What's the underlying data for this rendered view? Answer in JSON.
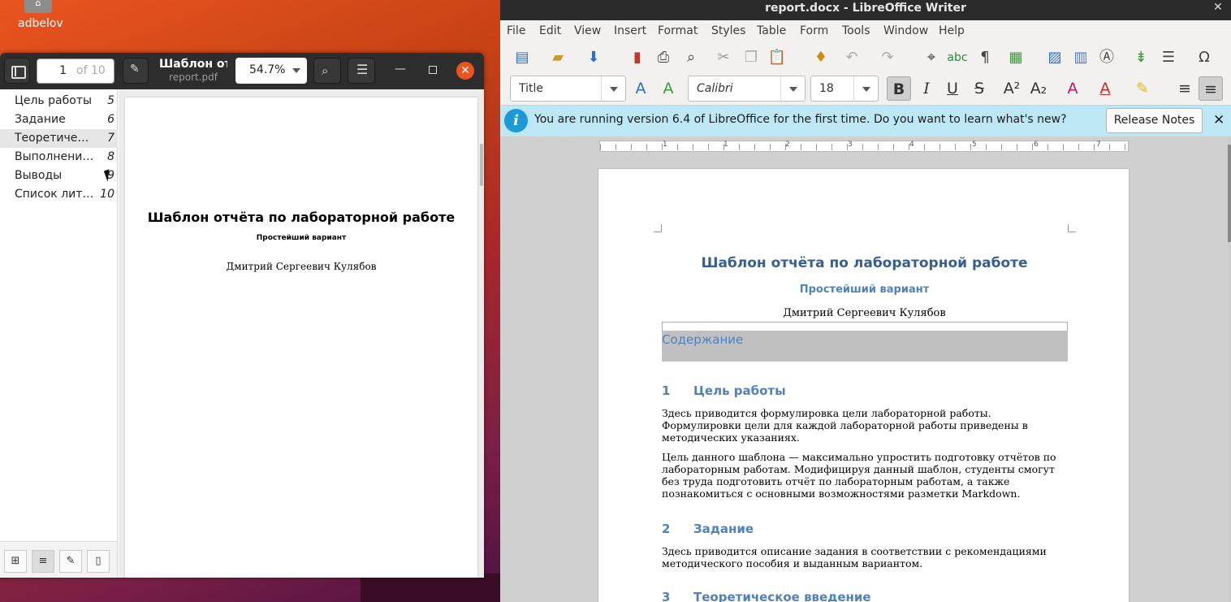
{
  "desktop": {
    "home_label": "adbelov",
    "home_icon_glyph": "⌂"
  },
  "evince": {
    "page_number": "1",
    "page_of": "of 10",
    "title": "Шаблон отчёта по лабораторной работе",
    "subtitle": "report.pdf",
    "zoom": "54.7%",
    "outline": [
      {
        "label": "Цель работы",
        "page": "5"
      },
      {
        "label": "Задание",
        "page": "6"
      },
      {
        "label": "Теоретическое введение",
        "page": "7"
      },
      {
        "label": "Выполнение лабораторной работы",
        "page": "8"
      },
      {
        "label": "Выводы",
        "page": "9"
      },
      {
        "label": "Список литературы",
        "page": "10"
      }
    ],
    "pdf_page": {
      "title": "Шаблон отчёта по лабораторной работе",
      "subtitle": "Простейший вариант",
      "author": "Дмитрий Сергеевич Кулябов"
    }
  },
  "writer": {
    "window_title": "report.docx - LibreOffice Writer",
    "menu": [
      "File",
      "Edit",
      "View",
      "Insert",
      "Format",
      "Styles",
      "Table",
      "Form",
      "Tools",
      "Window",
      "Help"
    ],
    "paragraph_style": "Title",
    "font_name": "Calibri",
    "font_size": "18",
    "infobar_text": "You are running version 6.4 of LibreOffice for the first time. Do you want to learn what's new?",
    "release_notes_label": "Release Notes",
    "ruler_numbers": [
      "1",
      "1",
      "2",
      "3",
      "4",
      "5",
      "6",
      "7"
    ],
    "document": {
      "title": "Шаблон отчёта по лабораторной работе",
      "subtitle": "Простейший вариант",
      "author": "Дмитрий Сергеевич Кулябов",
      "toc_title": "Содержание",
      "sections": [
        {
          "num": "1",
          "title": "Цель работы"
        },
        {
          "num": "2",
          "title": "Задание"
        },
        {
          "num": "3",
          "title": "Теоретическое введение"
        }
      ],
      "para1": "Здесь приводится формулировка цели лабораторной работы. Формулировки цели для каждой лабораторной работы приведены в методических указаниях.",
      "para2": "Цель данного шаблона — максимально упростить подготовку отчётов по лабораторным работам. Модифицируя данный шаблон, студенты смогут без труда подготовить отчёт по лабораторным работам, а также познакомиться с основными возможностями разметки Markdown.",
      "para3": "Здесь приводится описание задания в соответствии с рекомендациями методического пособия и выданным вариантом."
    }
  },
  "colors": {
    "ubuntu_orange": "#e95420",
    "heading_blue": "#4f81bd",
    "title_blue": "#365f91",
    "infobar_bg": "#bee7f5"
  }
}
